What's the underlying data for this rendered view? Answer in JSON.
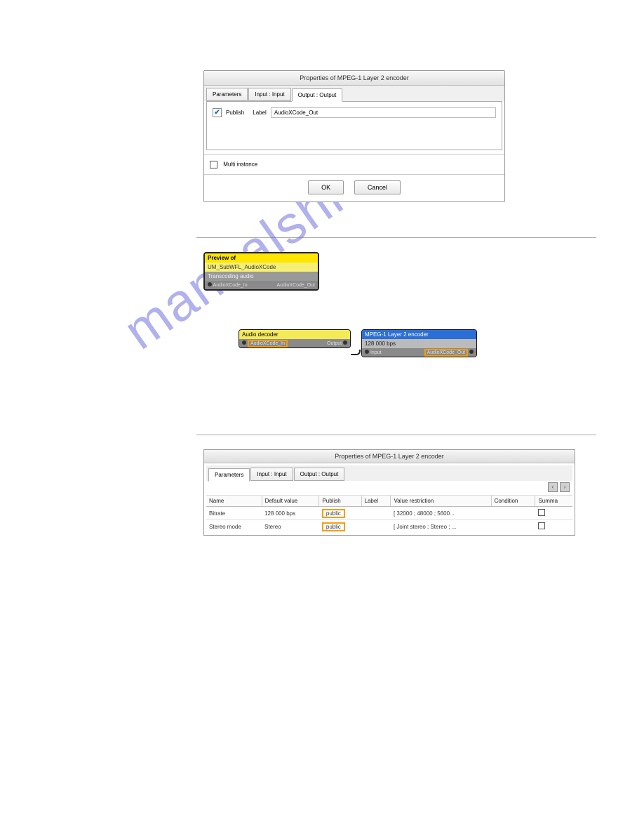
{
  "watermark": "manualshive.com",
  "dialog1": {
    "title": "Properties of MPEG-1 Layer 2 encoder",
    "tabs": {
      "params": "Parameters",
      "input": "Input : Input",
      "output": "Output : Output"
    },
    "publish_label": "Publish",
    "label_label": "Label",
    "label_value": "AudioXCode_Out",
    "multi_instance": "Multi instance",
    "ok": "OK",
    "cancel": "Cancel"
  },
  "nodes": {
    "preview": {
      "line1": "Preview of",
      "line2": "UM_SubWFL_AudioXCode",
      "line3": "Transcoding audio",
      "port_in": "AudioXCode_In",
      "port_out": "AudioXCode_Out"
    },
    "decoder": {
      "title": "Audio decoder",
      "port_in": "AudioXCode_In",
      "port_out": "Output"
    },
    "encoder": {
      "title": "MPEG-1 Layer 2 encoder",
      "subtitle": "128 000 bps",
      "port_in": "Input",
      "port_out": "AudioXCode_Out"
    }
  },
  "dialog3": {
    "title": "Properties of MPEG-1 Layer 2 encoder",
    "tabs": {
      "params": "Parameters",
      "input": "Input : Input",
      "output": "Output : Output"
    },
    "headers": {
      "name": "Name",
      "default": "Default value",
      "publish": "Publish",
      "label": "Label",
      "restriction": "Value restriction",
      "condition": "Condition",
      "summa": "Summa"
    },
    "rows": [
      {
        "name": "Bitrate",
        "default": "128 000 bps",
        "publish": "public",
        "label": "",
        "restriction": "[ 32000 ; 48000 ; 5600...",
        "condition": ""
      },
      {
        "name": "Stereo mode",
        "default": "Stereo",
        "publish": "public",
        "label": "",
        "restriction": "[ Joint stereo ; Stereo ; ...",
        "condition": ""
      }
    ]
  }
}
